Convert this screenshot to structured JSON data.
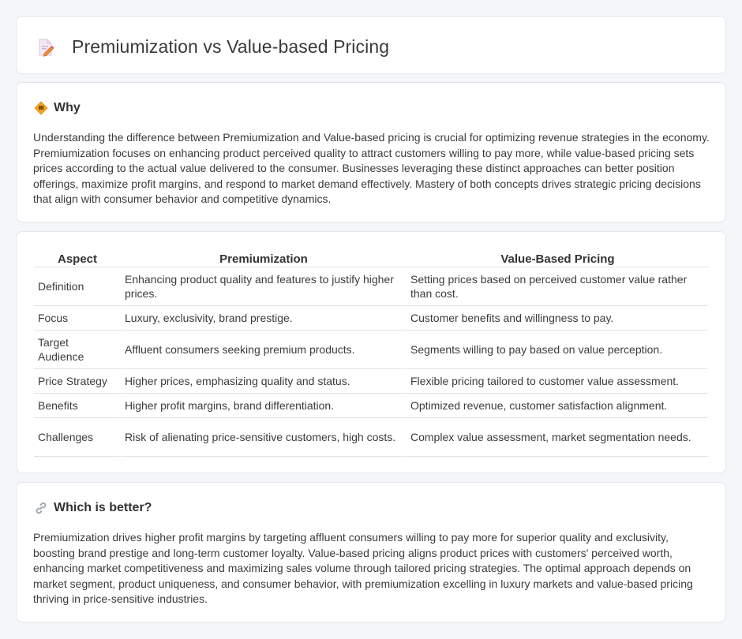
{
  "header": {
    "title": "Premiumization vs Value-based Pricing",
    "icon": "document-pencil-icon"
  },
  "why": {
    "heading": "Why",
    "icon": "diamond-warning-icon",
    "body": "Understanding the difference between Premiumization and Value-based pricing is crucial for optimizing revenue strategies in the economy. Premiumization focuses on enhancing product perceived quality to attract customers willing to pay more, while value-based pricing sets prices according to the actual value delivered to the consumer. Businesses leveraging these distinct approaches can better position offerings, maximize profit margins, and respond to market demand effectively. Mastery of both concepts drives strategic pricing decisions that align with consumer behavior and competitive dynamics."
  },
  "table": {
    "headers": [
      "Aspect",
      "Premiumization",
      "Value-Based Pricing"
    ],
    "rows": [
      [
        "Definition",
        "Enhancing product quality and features to justify higher prices.",
        "Setting prices based on perceived customer value rather than cost."
      ],
      [
        "Focus",
        "Luxury, exclusivity, brand prestige.",
        "Customer benefits and willingness to pay."
      ],
      [
        "Target Audience",
        "Affluent consumers seeking premium products.",
        "Segments willing to pay based on value perception."
      ],
      [
        "Price Strategy",
        "Higher prices, emphasizing quality and status.",
        "Flexible pricing tailored to customer value assessment."
      ],
      [
        "Benefits",
        "Higher profit margins, brand differentiation.",
        "Optimized revenue, customer satisfaction alignment."
      ],
      [
        "Challenges",
        "Risk of alienating price-sensitive customers, high costs.",
        "Complex value assessment, market segmentation needs."
      ]
    ]
  },
  "better": {
    "heading": "Which is better?",
    "icon": "link-icon",
    "body": "Premiumization drives higher profit margins by targeting affluent consumers willing to pay more for superior quality and exclusivity, boosting brand prestige and long-term customer loyalty. Value-based pricing aligns product prices with customers' perceived worth, enhancing market competitiveness and maximizing sales volume through tailored pricing strategies. The optimal approach depends on market segment, product uniqueness, and consumer behavior, with premiumization excelling in luxury markets and value-based pricing thriving in price-sensitive industries."
  },
  "colors": {
    "background": "#f4f6f9",
    "card": "#ffffff",
    "accent": "#f0a030",
    "border": "#e3e6ea"
  }
}
